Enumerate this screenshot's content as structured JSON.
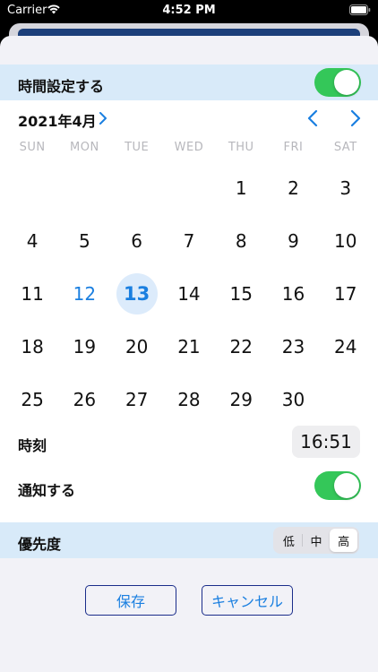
{
  "status_bar": {
    "carrier": "Carrier",
    "time": "4:52 PM"
  },
  "time_setting": {
    "label": "時間設定する",
    "enabled": true
  },
  "calendar": {
    "month_label": "2021年4月",
    "weekdays": [
      "SUN",
      "MON",
      "TUE",
      "WED",
      "THU",
      "FRI",
      "SAT"
    ],
    "weeks": [
      [
        "",
        "",
        "",
        "",
        "1",
        "2",
        "3"
      ],
      [
        "4",
        "5",
        "6",
        "7",
        "8",
        "9",
        "10"
      ],
      [
        "11",
        "12",
        "13",
        "14",
        "15",
        "16",
        "17"
      ],
      [
        "18",
        "19",
        "20",
        "21",
        "22",
        "23",
        "24"
      ],
      [
        "25",
        "26",
        "27",
        "28",
        "29",
        "30",
        ""
      ]
    ],
    "today": "12",
    "selected": "13"
  },
  "time": {
    "label": "時刻",
    "value": "16:51"
  },
  "notify": {
    "label": "通知する",
    "enabled": true
  },
  "priority": {
    "label": "優先度",
    "options": [
      "低",
      "中",
      "高"
    ],
    "selected": "高"
  },
  "buttons": {
    "save": "保存",
    "cancel": "キャンセル"
  },
  "colors": {
    "accent": "#1a7fe0",
    "toggle_on": "#34c759",
    "band": "#d8eaf9"
  }
}
